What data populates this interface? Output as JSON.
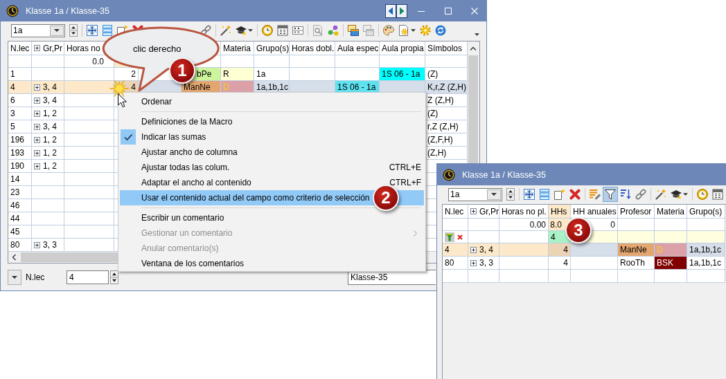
{
  "left_window": {
    "title": "Klasse 1a / Klasse-35",
    "class_field": {
      "value": "1a"
    },
    "table": {
      "columns": [
        {
          "label": "N.lec",
          "highlighted": false
        },
        {
          "label": "Gr,Pr",
          "expanded": false,
          "highlighted": false
        },
        {
          "label": "Horas no",
          "highlighted": false
        },
        {
          "highlighted": true
        },
        {
          "highlighted": false
        },
        {
          "highlighted": false
        },
        {
          "label": "Materia",
          "highlighted": false
        },
        {
          "label": "Grupo(s)",
          "highlighted": false
        },
        {
          "label": "Horas dobl.",
          "highlighted": false
        },
        {
          "label": "Aula espec",
          "highlighted": false
        },
        {
          "label": "Aula propia",
          "highlighted": false
        },
        {
          "label": "Símbolos",
          "highlighted": false
        }
      ],
      "rows": [
        {
          "kind": "sums",
          "cells": [
            {},
            {},
            {
              "text": "0.0"
            }
          ]
        },
        {
          "kind": "data",
          "selected": false,
          "cells": [
            {
              "text": "1"
            },
            {},
            {},
            {
              "text": "2"
            },
            {},
            {
              "text": "bPe",
              "color": "#ccf59c"
            },
            {
              "text": "R",
              "color": "#ffffd4"
            },
            {
              "text": "1a"
            },
            {},
            {},
            {
              "text": "1S 06 - 1a",
              "color": "#00ffff"
            },
            {
              "text": "(Z)"
            }
          ]
        },
        {
          "kind": "data",
          "selected": true,
          "cells": [
            {
              "text": "4"
            },
            {
              "text": "3, 4",
              "expanded": false
            },
            {},
            {
              "text": "4"
            },
            {},
            {
              "text": "ManNe",
              "color": "#e2a670"
            },
            {
              "text": "D",
              "color": "#dca0a8",
              "font": {
                "color": "#ffd700"
              }
            },
            {
              "text": "1a,1b,1c"
            },
            {},
            {
              "text": "1S 06 - 1a",
              "color": "#5ee2f0"
            },
            {},
            {
              "text": "K,r,Z (Z,H)"
            }
          ]
        },
        {
          "kind": "data",
          "selected": false,
          "cells": [
            {
              "text": "6"
            },
            {
              "text": "3, 4",
              "expanded": false
            },
            {},
            {},
            {},
            {},
            {},
            {},
            {},
            {},
            {},
            {
              "text": "Z (Z,H)"
            }
          ]
        },
        {
          "kind": "data",
          "selected": false,
          "cells": [
            {
              "text": "3"
            },
            {
              "text": "1, 2",
              "expanded": false
            },
            {},
            {},
            {},
            {},
            {},
            {},
            {},
            {},
            {},
            {
              "text": "(Z)"
            }
          ]
        },
        {
          "kind": "data",
          "selected": false,
          "cells": [
            {
              "text": "5"
            },
            {
              "text": "3, 4",
              "expanded": false
            },
            {},
            {},
            {},
            {},
            {},
            {},
            {},
            {},
            {},
            {
              "text": "r,Z (Z,H)"
            }
          ]
        },
        {
          "kind": "data",
          "selected": false,
          "cells": [
            {
              "text": "196"
            },
            {
              "text": "1, 2",
              "expanded": false
            },
            {},
            {},
            {},
            {},
            {},
            {},
            {},
            {},
            {},
            {
              "text": "(Z,F,H)"
            }
          ]
        },
        {
          "kind": "data",
          "selected": false,
          "cells": [
            {
              "text": "193"
            },
            {
              "text": "1, 2",
              "expanded": false
            },
            {},
            {},
            {},
            {},
            {},
            {},
            {},
            {},
            {},
            {
              "text": "(Z,H)"
            }
          ]
        },
        {
          "kind": "data",
          "selected": false,
          "cells": [
            {
              "text": "190"
            },
            {
              "text": "1, 2",
              "expanded": false
            }
          ]
        },
        {
          "kind": "data",
          "selected": false,
          "cells": [
            {
              "text": "14"
            }
          ]
        },
        {
          "kind": "data",
          "selected": false,
          "cells": [
            {
              "text": "23"
            }
          ]
        },
        {
          "kind": "data",
          "selected": false,
          "cells": [
            {
              "text": "46"
            }
          ]
        },
        {
          "kind": "data",
          "selected": false,
          "cells": [
            {
              "text": "44"
            }
          ]
        },
        {
          "kind": "data",
          "selected": false,
          "cells": [
            {
              "text": "45"
            }
          ]
        },
        {
          "kind": "data",
          "selected": false,
          "cells": [
            {
              "text": "80"
            },
            {
              "text": "3, 3",
              "expanded": false
            }
          ]
        }
      ]
    },
    "bottom_bar": {
      "sort_field": "N.lec",
      "value": "4",
      "class_name": "Klasse-35"
    }
  },
  "context_menu": {
    "items": [
      {
        "kind": "item",
        "label": "Ordenar",
        "checked": false,
        "disabled": false,
        "selected": false,
        "submenu": false
      },
      {
        "kind": "separator"
      },
      {
        "kind": "item",
        "label": "Definiciones de la Macro",
        "checked": false,
        "disabled": false,
        "selected": false,
        "submenu": false
      },
      {
        "kind": "item",
        "label": "Indicar las sumas",
        "checked": true,
        "disabled": false,
        "selected": false,
        "submenu": false
      },
      {
        "kind": "item",
        "label": "Ajustar ancho de columna",
        "checked": false,
        "disabled": false,
        "selected": false,
        "submenu": false
      },
      {
        "kind": "item",
        "label": "Ajustar todas las colum.",
        "shortcut": "CTRL+E",
        "checked": false,
        "disabled": false,
        "selected": false,
        "submenu": false
      },
      {
        "kind": "item",
        "label": "Adaptar el ancho al contenido",
        "shortcut": "CTRL+F",
        "checked": false,
        "disabled": false,
        "selected": false,
        "submenu": false
      },
      {
        "kind": "item",
        "label": "Usar el contenido actual del campo como criterio de selección",
        "checked": false,
        "disabled": false,
        "selected": true,
        "submenu": false
      },
      {
        "kind": "separator"
      },
      {
        "kind": "item",
        "label": "Escribir un comentario",
        "checked": false,
        "disabled": false,
        "selected": false,
        "submenu": false
      },
      {
        "kind": "item",
        "label": "Gestionar un comentario",
        "checked": false,
        "disabled": true,
        "selected": false,
        "submenu": true
      },
      {
        "kind": "item",
        "label": "Anular comentario(s)",
        "checked": false,
        "disabled": true,
        "selected": false,
        "submenu": false
      },
      {
        "kind": "item",
        "label": "Ventana de los comentarios",
        "checked": false,
        "disabled": false,
        "selected": false,
        "submenu": false
      }
    ]
  },
  "callout": {
    "text": "clic derecho"
  },
  "step_badges": [
    {
      "number": "1"
    },
    {
      "number": "2"
    },
    {
      "number": "3"
    }
  ],
  "right_window": {
    "title": "Klasse 1a / Klasse-35",
    "class_field": {
      "value": "1a"
    },
    "toolbar": {
      "filter_on": true
    },
    "table": {
      "columns": [
        {
          "label": "N.lec",
          "highlighted": false
        },
        {
          "label": "Gr,Pr",
          "expanded": false,
          "highlighted": false
        },
        {
          "label": "Horas no pl.",
          "highlighted": false
        },
        {
          "label": "HHs",
          "highlighted": true
        },
        {
          "label": "HH anuales",
          "highlighted": false
        },
        {
          "label": "Profesor",
          "highlighted": false
        },
        {
          "label": "Materia",
          "highlighted": false
        },
        {
          "label": "Grupo(s)",
          "highlighted": false
        }
      ],
      "rows": [
        {
          "kind": "sums",
          "cells": [
            {},
            {},
            {
              "text": "0.00"
            },
            {
              "text": "8.0"
            },
            {
              "text": "0"
            }
          ]
        },
        {
          "kind": "filter",
          "cells": [
            {},
            {},
            {},
            {
              "text": "4",
              "color": "#a9f1c6"
            },
            {
              "color": "#ffffe0"
            },
            {
              "color": "#ffffe0"
            },
            {
              "color": "#ffffe0"
            },
            {
              "color": "#ffffe0"
            }
          ]
        },
        {
          "kind": "data",
          "selected": true,
          "cells": [
            {
              "text": "4"
            },
            {
              "text": "3, 4",
              "expanded": false
            },
            {},
            {
              "text": "4"
            },
            {},
            {
              "text": "ManNe",
              "color": "#e2a670"
            },
            {
              "text": "D",
              "color": "#dca0a8",
              "font": {
                "color": "#ffd700"
              }
            },
            {
              "text": "1a,1b,1c"
            }
          ]
        },
        {
          "kind": "data",
          "selected": false,
          "cells": [
            {
              "text": "80"
            },
            {
              "text": "3, 3",
              "expanded": false
            },
            {},
            {
              "text": "4"
            },
            {},
            {
              "text": "RooTh"
            },
            {
              "text": "BSK",
              "color": "#800000",
              "font": {
                "color": "#ffffff"
              }
            },
            {
              "text": "1a,1b,1c"
            }
          ]
        },
        {
          "kind": "blank"
        }
      ]
    }
  }
}
